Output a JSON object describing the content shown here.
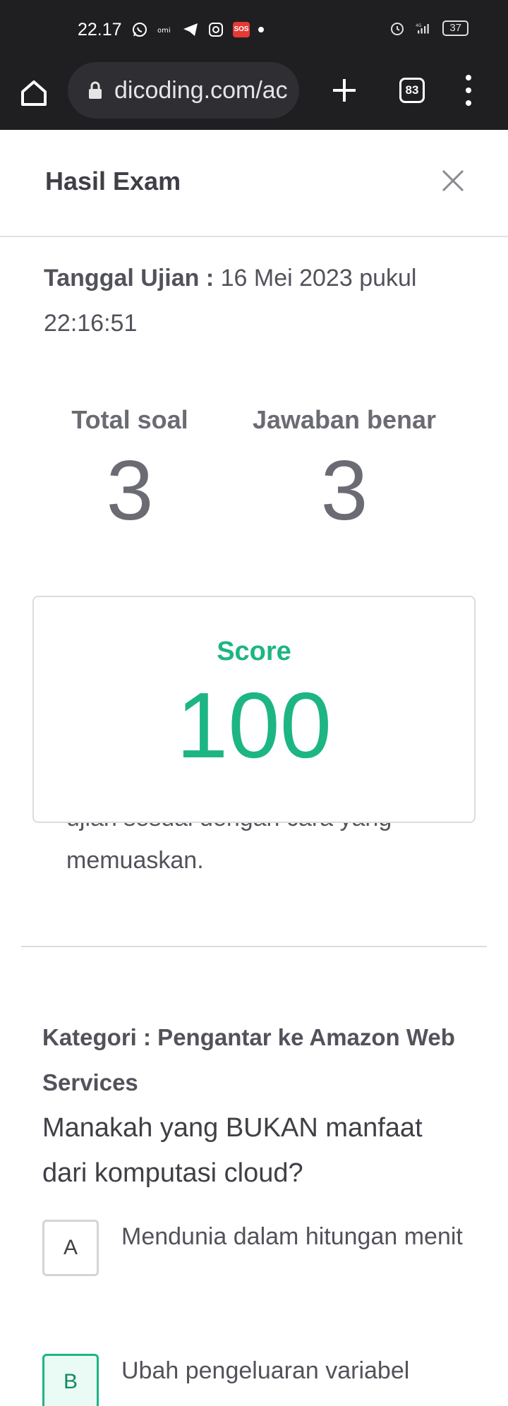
{
  "status_bar": {
    "time": "22.17",
    "left_icons": [
      "whatsapp-icon",
      "omi-icon",
      "telegram-icon",
      "instagram-icon",
      "sos-icon",
      "dot-icon"
    ],
    "sos_label": "SOS",
    "network": "4G",
    "battery": "37"
  },
  "browser": {
    "url": "dicoding.com/ac",
    "tab_count": "83"
  },
  "modal": {
    "title": "Hasil Exam"
  },
  "exam": {
    "date_label": "Tanggal Ujian :",
    "date_value": "16 Mei 2023 pukul 22:16:51",
    "total_label": "Total soal",
    "total_value": "3",
    "correct_label": "Jawaban benar",
    "correct_value": "3",
    "score_label": "Score",
    "score_value": "100"
  },
  "previous_answer": {
    "cut_text": "ujian sesuai dengan cara yang",
    "text": "memuaskan."
  },
  "question": {
    "category": "Kategori : Pengantar ke Amazon Web Services",
    "text": "Manakah yang BUKAN manfaat dari komputasi cloud?",
    "options": [
      {
        "letter": "A",
        "text": "Mendunia dalam hitungan menit"
      },
      {
        "letter": "B",
        "text": "Ubah pengeluaran variabel"
      }
    ]
  },
  "colors": {
    "accent": "#1db584",
    "status_bar_bg": "#1f1f22"
  }
}
